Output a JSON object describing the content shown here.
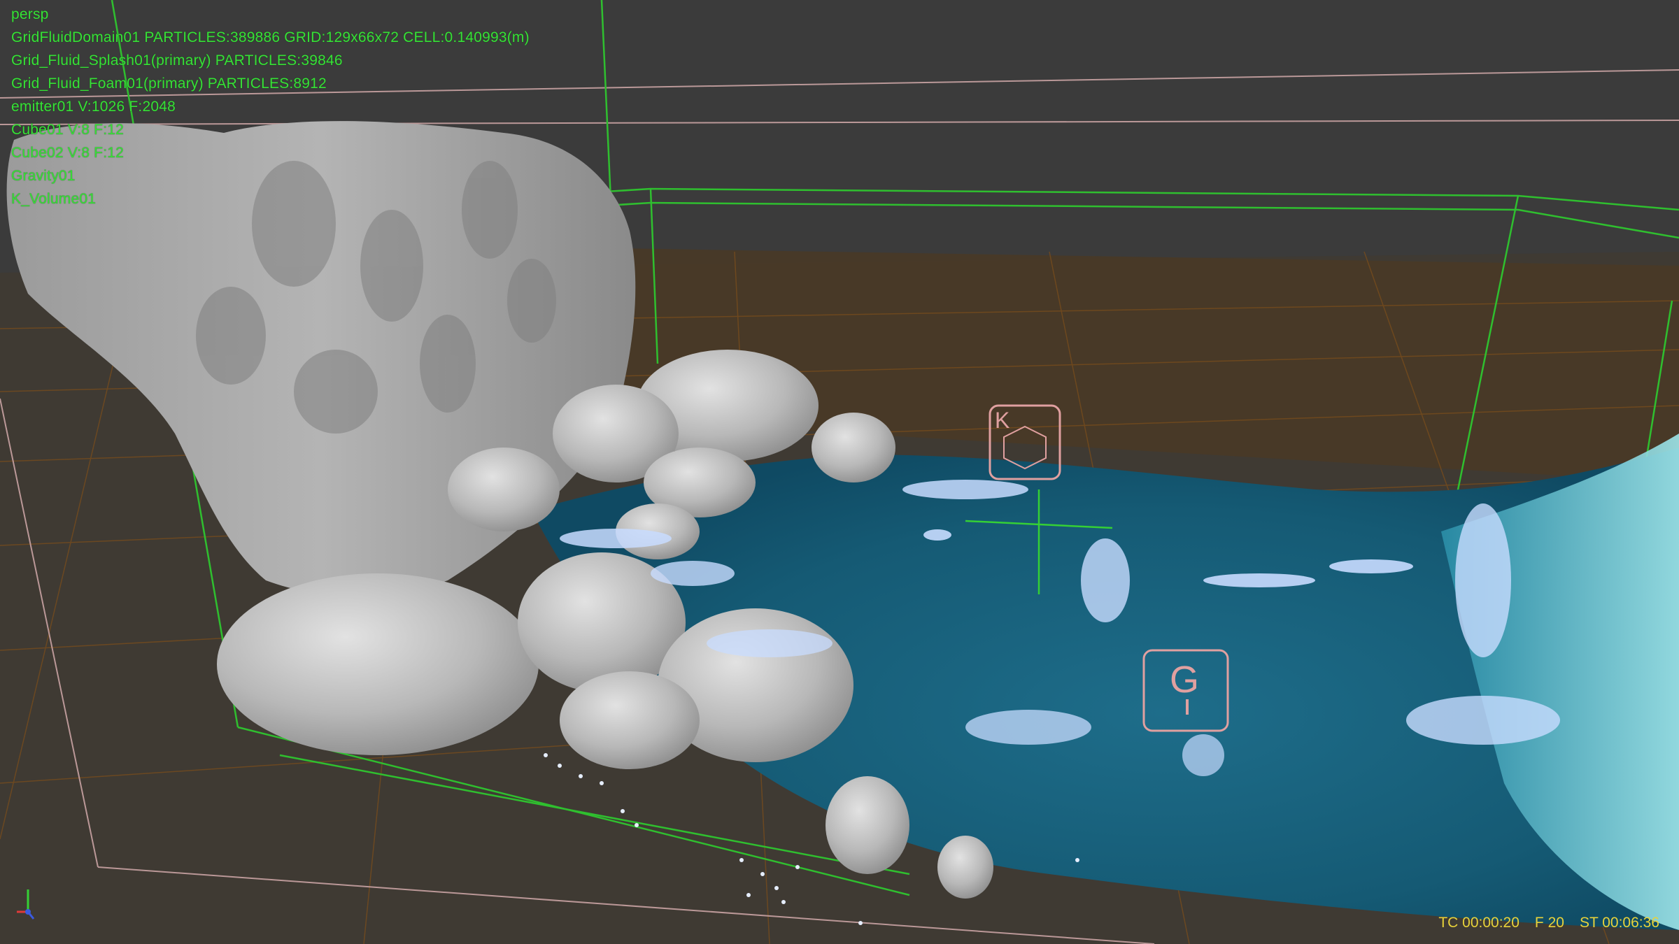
{
  "viewport": {
    "camera": "persp",
    "objects": [
      "GridFluidDomain01 PARTICLES:389886 GRID:129x66x72 CELL:0.140993(m)",
      "Grid_Fluid_Splash01(primary) PARTICLES:39846",
      "Grid_Fluid_Foam01(primary) PARTICLES:8912",
      "emitter01 V:1026 F:2048",
      "Cube01 V:8 F:12",
      "Cube02 V:8 F:12",
      "Gravity01",
      "K_Volume01"
    ],
    "gizmos": {
      "k_label": "K",
      "g_label": "G"
    },
    "status": {
      "tc": "TC 00:00:20",
      "frame": "F 20",
      "st": "ST 00:06:36"
    }
  },
  "colors": {
    "hud_text": "#38e038",
    "status_text": "#e8d23a",
    "background": "#3b3b3b",
    "floor_grid": "#7a4d1c",
    "domain_box": "#2fbf2f",
    "bounds_box": "#c9a3a3",
    "water": "#1f6f8c",
    "foam": "#c8dcff",
    "mesh": "#b9b9b9"
  },
  "icons": [
    "axis-gizmo-icon",
    "kill-volume-icon",
    "gravity-icon"
  ]
}
